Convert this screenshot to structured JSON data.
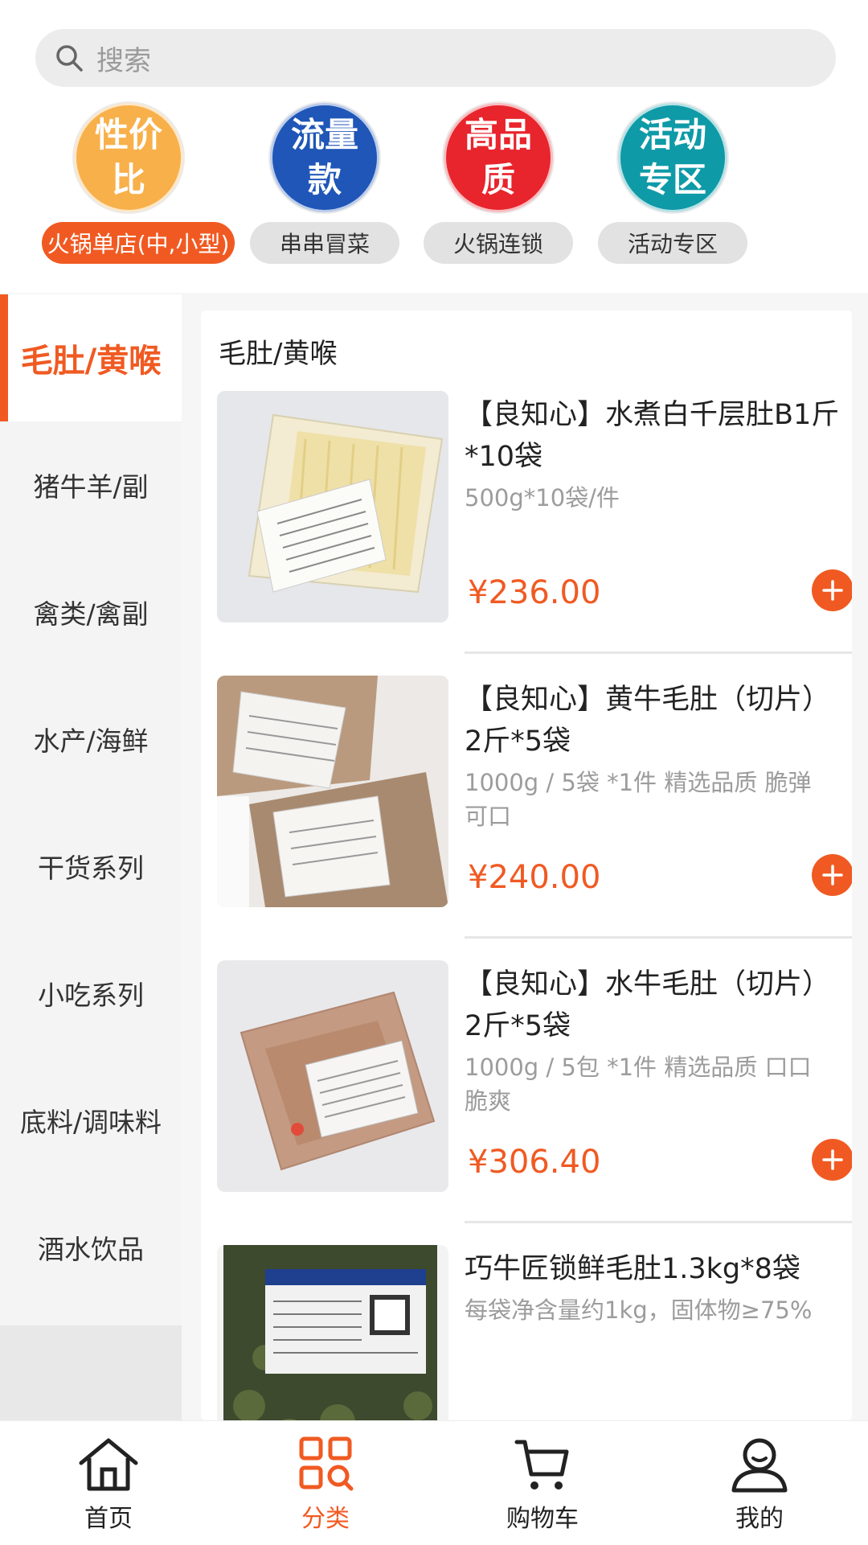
{
  "search": {
    "placeholder": "搜索"
  },
  "categories": [
    {
      "circle_text": "性价比",
      "label": "火锅单店(中,小型)",
      "color": "#f8b04a",
      "active": true
    },
    {
      "circle_text": "流量款",
      "label": "串串冒菜",
      "color": "#1f56b8",
      "active": false
    },
    {
      "circle_text": "高品质",
      "label": "火锅连锁",
      "color": "#e8242c",
      "active": false
    },
    {
      "circle_text": "活动专区",
      "label": "活动专区",
      "color": "#0e9aa7",
      "active": false
    }
  ],
  "sidebar": {
    "items": [
      {
        "label": "毛肚/黄喉",
        "active": true
      },
      {
        "label": "猪牛羊/副"
      },
      {
        "label": "禽类/禽副"
      },
      {
        "label": "水产/海鲜"
      },
      {
        "label": "干货系列"
      },
      {
        "label": "小吃系列"
      },
      {
        "label": "底料/调味料"
      },
      {
        "label": "酒水饮品"
      }
    ]
  },
  "section": {
    "title": "毛肚/黄喉"
  },
  "products": [
    {
      "name": "【良知心】水煮白千层肚B1斤*10袋",
      "desc": "500g*10袋/件",
      "price": "¥236.00"
    },
    {
      "name": "【良知心】黄牛毛肚（切片）2斤*5袋",
      "desc": "1000g / 5袋 *1件 精选品质 脆弹可口",
      "price": "¥240.00"
    },
    {
      "name": "【良知心】水牛毛肚（切片）2斤*5袋",
      "desc": "1000g / 5包 *1件 精选品质 口口脆爽",
      "price": "¥306.40"
    },
    {
      "name": "巧牛匠锁鲜毛肚1.3kg*8袋",
      "desc": "每袋净含量约1kg，固体物≥75%",
      "price": ""
    }
  ],
  "tabbar": {
    "items": [
      {
        "label": "首页",
        "icon": "home-icon"
      },
      {
        "label": "分类",
        "icon": "category-icon",
        "active": true
      },
      {
        "label": "购物车",
        "icon": "cart-icon"
      },
      {
        "label": "我的",
        "icon": "profile-icon"
      }
    ]
  },
  "colors": {
    "accent": "#f05a22"
  }
}
